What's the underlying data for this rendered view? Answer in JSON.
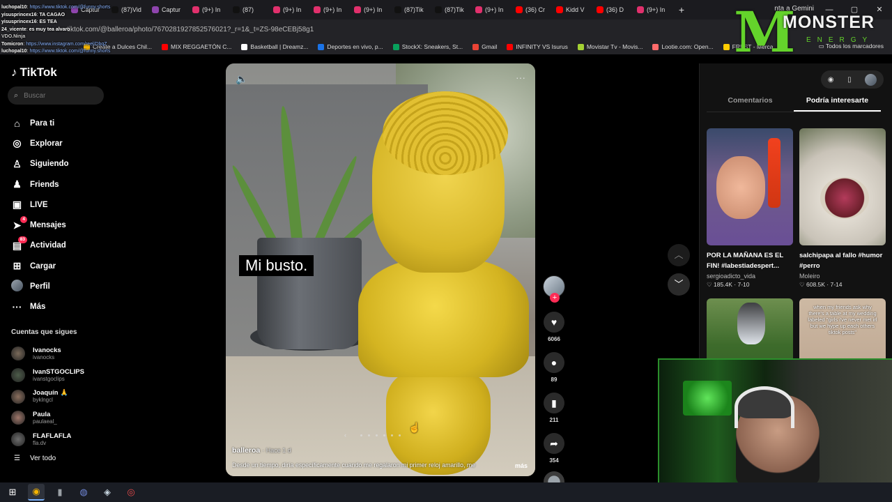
{
  "browser": {
    "tabs": [
      {
        "label": "Captur",
        "color": "#8e44ad"
      },
      {
        "label": "(87)Vid",
        "color": "#111111"
      },
      {
        "label": "Captur",
        "color": "#8e44ad"
      },
      {
        "label": "(9+) In",
        "color": "#e1306c"
      },
      {
        "label": "(87)",
        "color": "#111111"
      },
      {
        "label": "(9+) In",
        "color": "#e1306c"
      },
      {
        "label": "(9+) In",
        "color": "#e1306c"
      },
      {
        "label": "(9+) In",
        "color": "#e1306c"
      },
      {
        "label": "(87)Tik",
        "color": "#111111"
      },
      {
        "label": "(87)Tik",
        "color": "#111111"
      },
      {
        "label": "(9+) In",
        "color": "#e1306c"
      },
      {
        "label": "(36) Cr",
        "color": "#ff0000"
      },
      {
        "label": "Kidd V",
        "color": "#ff0000"
      },
      {
        "label": "(36) D",
        "color": "#ff0000"
      },
      {
        "label": "(9+) In",
        "color": "#e1306c"
      }
    ],
    "gemini_label": "nta a Gemini",
    "url": "tiktok.com/@balleroa/photo/7670281927852576021?_r=1&_t=ZS-98eCEBj58g1",
    "bookmarks": [
      {
        "label": "Create a Dulces Chil...",
        "color": "#f4b400"
      },
      {
        "label": "MIX REGGAETÓN C...",
        "color": "#ff0000"
      },
      {
        "label": "Basketball | Dreamz...",
        "color": "#ffffff"
      },
      {
        "label": "Deportes en vivo, p...",
        "color": "#1a73e8"
      },
      {
        "label": "StockX: Sneakers, St...",
        "color": "#08a05c"
      },
      {
        "label": "Gmail",
        "color": "#ea4335"
      },
      {
        "label": "INFINITY VS Isurus",
        "color": "#ff0000"
      },
      {
        "label": "Movistar Tv - Movis...",
        "color": "#a4d233"
      },
      {
        "label": "Lootie.com: Open...",
        "color": "#ff6b6b"
      },
      {
        "label": "FREST - Merca",
        "color": "#ffcc00"
      }
    ],
    "all_bookmarks": "Todos los marcadores"
  },
  "chat": [
    {
      "user": "luchopal10",
      "msg": "https://www.tiktok.com/@funny.shorts",
      "link": true
    },
    {
      "user": "yisusprincex16",
      "msg": "TA CAGAO",
      "link": false
    },
    {
      "user": "yisusprincex16",
      "msg": "ES TEA",
      "link": false
    },
    {
      "user": "24_vicente",
      "msg": "es muy tea alvaro",
      "link": false
    },
    {
      "user": "Tomicron",
      "msg": "https://www.instagram.com/reel/DbqZ",
      "link": true
    },
    {
      "user": "luchopal10",
      "msg": "https://www.tiktok.com/@funny.shorts",
      "link": true
    }
  ],
  "chat_extra": [
    "VDO.Ninja"
  ],
  "overlay": {
    "brand": "MONSTER",
    "sub": "ENERGY"
  },
  "tiktok": {
    "logo": "TikTok",
    "search_placeholder": "Buscar",
    "nav": [
      {
        "label": "Para ti",
        "icon": "home-icon",
        "glyph": "⌂",
        "badge": ""
      },
      {
        "label": "Explorar",
        "icon": "compass-icon",
        "glyph": "◎",
        "badge": ""
      },
      {
        "label": "Siguiendo",
        "icon": "following-icon",
        "glyph": "♙",
        "badge": ""
      },
      {
        "label": "Friends",
        "icon": "friends-icon",
        "glyph": "♟",
        "badge": ""
      },
      {
        "label": "LIVE",
        "icon": "live-icon",
        "glyph": "▣",
        "badge": ""
      },
      {
        "label": "Mensajes",
        "icon": "send-icon",
        "glyph": "➤",
        "badge": "4"
      },
      {
        "label": "Actividad",
        "icon": "bell-icon",
        "glyph": "▤",
        "badge": "83"
      },
      {
        "label": "Cargar",
        "icon": "upload-icon",
        "glyph": "⊞",
        "badge": ""
      },
      {
        "label": "Perfil",
        "icon": "avatar",
        "glyph": "",
        "badge": ""
      },
      {
        "label": "Más",
        "icon": "more-icon",
        "glyph": "···",
        "badge": ""
      }
    ],
    "following_title": "Cuentas que sigues",
    "following": [
      {
        "name": "Ivanocks",
        "handle": "ivanocks",
        "color": "#7a6a5a"
      },
      {
        "name": "IvanSTGOCLIPS",
        "handle": "ivanstgoclips",
        "color": "#4d5c4a"
      },
      {
        "name": "Joaquín 🙏",
        "handle": "byklngcl",
        "color": "#8b6f5e"
      },
      {
        "name": "Paula",
        "handle": "paulaeal_",
        "color": "#a0786b"
      },
      {
        "name": "FLAFLAFLA",
        "handle": "fla.dv",
        "color": "#6d6d6d"
      }
    ],
    "see_all": "Ver todo"
  },
  "video": {
    "caption_overlay": "Mi busto.",
    "author": "balleroa",
    "time": "· Hace 1 d",
    "description": "Desde un tiempo, diría específicamente cuando me regalaron mi primer reloj amarillo, me",
    "more": "más",
    "likes": "6066",
    "comments": "89",
    "saves": "211",
    "shares": "354"
  },
  "right_panel": {
    "tabs": [
      "Comentarios",
      "Podría interesarte"
    ],
    "active_tab": 1,
    "cards": [
      {
        "title": "POR LA MAÑANA ES EL FIN! #labestiadespert...",
        "author": "sergioadicto_vida",
        "likes": "185.4K",
        "date": "7-10"
      },
      {
        "title": "salchipapa al fallo #humor #perro",
        "author": "Moleiro",
        "likes": "608.5K",
        "date": "7-14"
      },
      {
        "title": "",
        "author": "",
        "likes": "",
        "date": ""
      },
      {
        "title": "when my friends ask why there's a table at my wedding labeled \"girls i've never met irl but we hype up each others tiktok posts\"",
        "author": "",
        "likes": "",
        "date": ""
      }
    ]
  },
  "colors": {
    "accent": "#fe2c55",
    "monster_green": "#64d32b"
  }
}
